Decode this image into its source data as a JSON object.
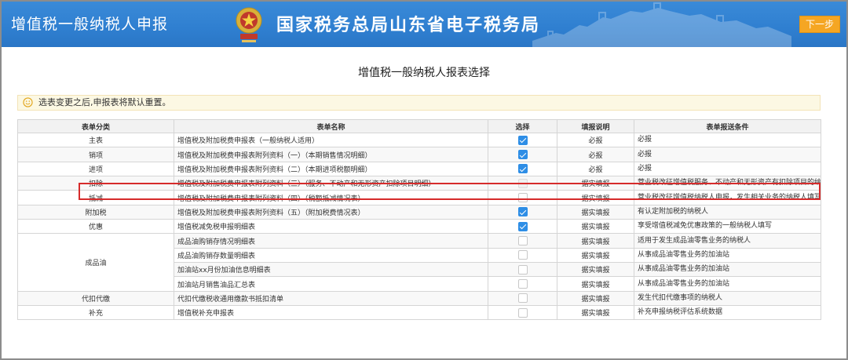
{
  "header": {
    "app_title": "增值税一般纳税人申报",
    "bureau_title": "国家税务总局山东省电子税务局",
    "next_label": "下一步",
    "emblem_icon": "tax-emblem-icon"
  },
  "page_title": "增值税一般纳税人报表选择",
  "notice": {
    "text": "选表变更之后,申报表将默认重置。",
    "icon": "smile-icon"
  },
  "table": {
    "headers": [
      "表单分类",
      "表单名称",
      "选择",
      "填报说明",
      "表单报送条件"
    ],
    "rows": [
      {
        "category": "主表",
        "name": "增值税及附加税费申报表（一般纳税人适用）",
        "checked": true,
        "disabled": false,
        "note": "必报",
        "condition": "必报"
      },
      {
        "category": "销项",
        "name": "增值税及附加税费申报表附列资料（一）（本期销售情况明细）",
        "checked": true,
        "disabled": false,
        "note": "必报",
        "condition": "必报"
      },
      {
        "category": "进项",
        "name": "增值税及附加税费申报表附列资料（二）（本期进项税额明细）",
        "checked": true,
        "disabled": false,
        "note": "必报",
        "condition": "必报"
      },
      {
        "category": "扣除",
        "name": "增值税及附加税费申报表附列资料（三）（服务、不动产和无形资产扣除项目明细）",
        "checked": false,
        "disabled": true,
        "note": "据实填报",
        "condition": "营业税改征增值税服务、不动产和无形资产有扣除项目的纳税人。有扣除项目的营业税改增值税纳税人填写，其他纳税人可不填。"
      },
      {
        "category": "抵减",
        "name": "增值税及附加税费申报表附列资料（四）（税额抵减情况表）",
        "checked": false,
        "disabled": false,
        "note": "据实填报",
        "condition": "营业税改征增值税纳税人申报，发生相关业务的纳税人填写，其他纳税人可不填"
      },
      {
        "category": "附加税",
        "name": "增值税及附加税费申报表附列资料（五）（附加税费情况表）",
        "checked": true,
        "disabled": false,
        "note": "据实填报",
        "condition": "有认定附加税的纳税人"
      },
      {
        "category": "优惠",
        "name": "增值税减免税申报明细表",
        "checked": true,
        "disabled": false,
        "note": "据实填报",
        "condition": "享受增值税减免优惠政策的一般纳税人填写"
      },
      {
        "category": "成品油",
        "name": "成品油购销存情况明细表",
        "checked": false,
        "disabled": false,
        "note": "据实填报",
        "condition": "适用于发生成品油零售业务的纳税人"
      },
      {
        "category": "",
        "name": "成品油购销存数量明细表",
        "checked": false,
        "disabled": false,
        "note": "据实填报",
        "condition": "从事成品油零售业务的加油站"
      },
      {
        "category": "",
        "name": "加油站xx月份加油信息明细表",
        "checked": false,
        "disabled": false,
        "note": "据实填报",
        "condition": "从事成品油零售业务的加油站"
      },
      {
        "category": "",
        "name": "加油站月销售油品汇总表",
        "checked": false,
        "disabled": false,
        "note": "据实填报",
        "condition": "从事成品油零售业务的加油站"
      },
      {
        "category": "代扣代缴",
        "name": "代扣代缴税收通用缴款书抵扣清单",
        "checked": false,
        "disabled": false,
        "note": "据实填报",
        "condition": "发生代扣代缴事项的纳税人"
      },
      {
        "category": "补充",
        "name": "增值税补充申报表",
        "checked": false,
        "disabled": false,
        "note": "据实填报",
        "condition": "补充申报纳税评估系统数据"
      }
    ]
  },
  "colors": {
    "header_blue": "#2f7fd0",
    "next_orange": "#f5a623",
    "checkbox_blue": "#2e8ee6",
    "highlight_red": "#d62b2b"
  }
}
